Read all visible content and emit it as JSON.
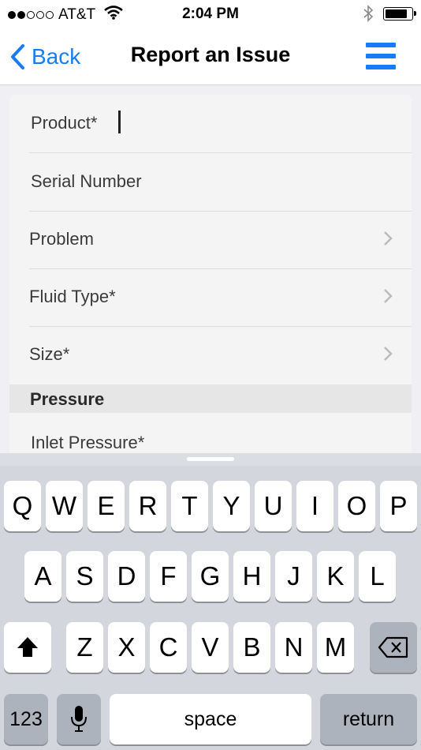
{
  "status_bar": {
    "carrier": "AT&T",
    "time": "2:04 PM",
    "signal_bars_filled": 2,
    "signal_bars_total": 5,
    "battery_level": 0.85
  },
  "nav": {
    "back_label": "Back",
    "title": "Report an Issue"
  },
  "form": {
    "product_label": "Product*",
    "serial_label": "Serial Number",
    "problem_label": "Problem",
    "fluid_label": "Fluid Type*",
    "size_label": "Size*",
    "section_pressure": "Pressure",
    "inlet_label": "Inlet Pressure*"
  },
  "keyboard": {
    "row1": [
      "Q",
      "W",
      "E",
      "R",
      "T",
      "Y",
      "U",
      "I",
      "O",
      "P"
    ],
    "row2": [
      "A",
      "S",
      "D",
      "F",
      "G",
      "H",
      "J",
      "K",
      "L"
    ],
    "row3": [
      "Z",
      "X",
      "C",
      "V",
      "B",
      "N",
      "M"
    ],
    "numbers_label": "123",
    "space_label": "space",
    "return_label": "return"
  },
  "colors": {
    "accent": "#1a7cf5"
  },
  "icons": {
    "wifi": "wifi-icon",
    "bluetooth": "bluetooth-icon",
    "battery": "battery-icon",
    "back": "chevron-left-icon",
    "menu": "hamburger-menu-icon",
    "chevron": "chevron-right-icon",
    "shift": "shift-icon",
    "delete": "backspace-icon",
    "mic": "microphone-icon"
  }
}
